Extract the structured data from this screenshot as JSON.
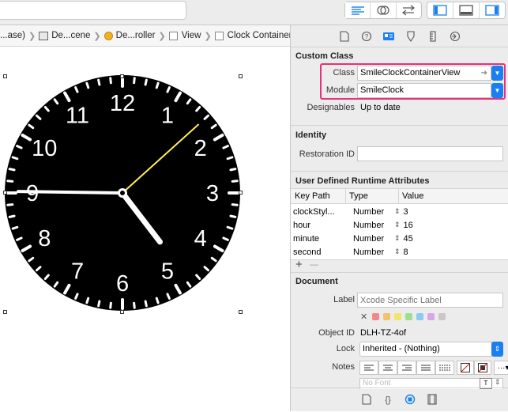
{
  "breadcrumb": [
    {
      "label": "...ase)",
      "icon": "folder-icon"
    },
    {
      "label": "De...cene",
      "icon": "scene-icon"
    },
    {
      "label": "De...roller",
      "icon": "view-controller-icon"
    },
    {
      "label": "View",
      "icon": "view-icon"
    },
    {
      "label": "Clock Container",
      "icon": "view-icon"
    }
  ],
  "clock": {
    "numerals": [
      "12",
      "1",
      "2",
      "3",
      "4",
      "5",
      "6",
      "7",
      "8",
      "9",
      "10",
      "11"
    ],
    "hour": 16,
    "minute": 45,
    "second": 8,
    "hand_color": "#ffffff",
    "second_hand_color": "#ffee55",
    "face_color": "#000000"
  },
  "inspector": {
    "custom_class": {
      "title": "Custom Class",
      "class_label": "Class",
      "class_value": "SmileClockContainerView",
      "module_label": "Module",
      "module_value": "SmileClock",
      "designables_label": "Designables",
      "designables_value": "Up to date"
    },
    "identity": {
      "title": "Identity",
      "restoration_label": "Restoration ID",
      "restoration_value": ""
    },
    "runtime": {
      "title": "User Defined Runtime Attributes",
      "headers": [
        "Key Path",
        "Type",
        "Value"
      ],
      "rows": [
        {
          "key": "clockStyl...",
          "type": "Number",
          "value": "3"
        },
        {
          "key": "hour",
          "type": "Number",
          "value": "16"
        },
        {
          "key": "minute",
          "type": "Number",
          "value": "45"
        },
        {
          "key": "second",
          "type": "Number",
          "value": "8"
        }
      ],
      "add": "+",
      "remove": "—"
    },
    "document": {
      "title": "Document",
      "label_label": "Label",
      "label_placeholder": "Xcode Specific Label",
      "swatches": [
        "#f08a8a",
        "#f5c26b",
        "#f2e56b",
        "#9be08f",
        "#8fc8f0",
        "#d8a6e8",
        "#c8c8c8"
      ],
      "object_id_label": "Object ID",
      "object_id_value": "DLH-TZ-4of",
      "lock_label": "Lock",
      "lock_value": "Inherited - (Nothing)",
      "notes_label": "Notes",
      "font_placeholder": "No Font"
    }
  }
}
